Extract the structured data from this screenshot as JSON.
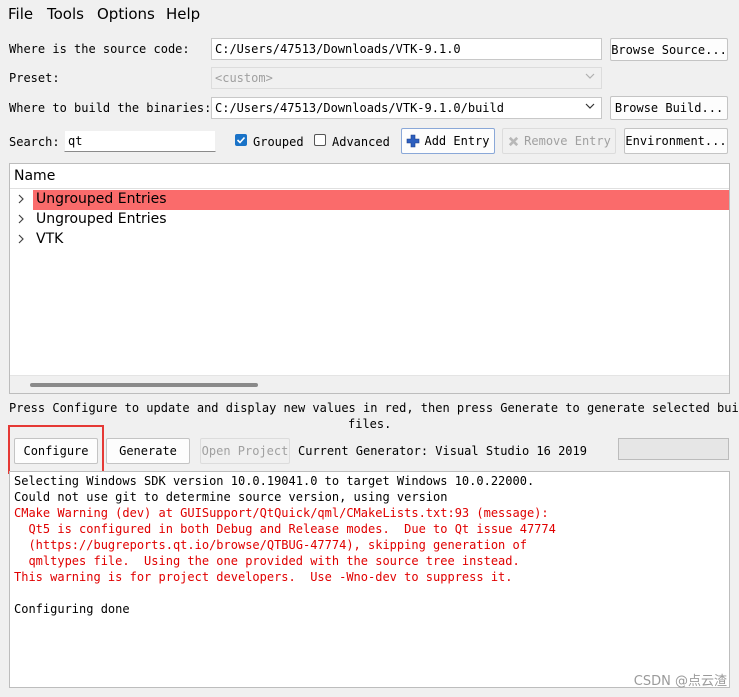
{
  "menu": [
    "File",
    "Tools",
    "Options",
    "Help"
  ],
  "source": {
    "label": "Where is the source code:",
    "value": "C:/Users/47513/Downloads/VTK-9.1.0",
    "browse_label": "Browse Source..."
  },
  "preset": {
    "label": "Preset:",
    "value": "<custom>"
  },
  "build": {
    "label": "Where to build the binaries:",
    "value": "C:/Users/47513/Downloads/VTK-9.1.0/build",
    "browse_label": "Browse Build..."
  },
  "search": {
    "label": "Search:",
    "value": "qt"
  },
  "options": {
    "grouped_label": "Grouped",
    "grouped_checked": true,
    "advanced_label": "Advanced",
    "advanced_checked": false,
    "add_entry_label": "Add Entry",
    "remove_entry_label": "Remove Entry",
    "environment_label": "Environment..."
  },
  "tree": {
    "header": "Name",
    "rows": [
      {
        "label": "Ungrouped Entries",
        "highlighted": true
      },
      {
        "label": "Ungrouped Entries",
        "highlighted": false
      },
      {
        "label": "VTK",
        "highlighted": false
      }
    ]
  },
  "hint": {
    "line1": "Press Configure to update and display new values in red, then press Generate to generate selected build",
    "line2": "files."
  },
  "actions": {
    "configure_label": "Configure",
    "generate_label": "Generate",
    "open_project_label": "Open Project",
    "generator_text": "Current Generator: Visual Studio 16 2019"
  },
  "output": [
    {
      "text": "Selecting Windows SDK version 10.0.19041.0 to target Windows 10.0.22000.",
      "red": false
    },
    {
      "text": "Could not use git to determine source version, using version",
      "red": false
    },
    {
      "text": "CMake Warning (dev) at GUISupport/QtQuick/qml/CMakeLists.txt:93 (message):",
      "red": true
    },
    {
      "text": "  Qt5 is configured in both Debug and Release modes.  Due to Qt issue 47774",
      "red": true
    },
    {
      "text": "  (https://bugreports.qt.io/browse/QTBUG-47774), skipping generation of",
      "red": true
    },
    {
      "text": "  qmltypes file.  Using the one provided with the source tree instead.",
      "red": true
    },
    {
      "text": "This warning is for project developers.  Use -Wno-dev to suppress it.",
      "red": true
    },
    {
      "text": "",
      "red": false
    },
    {
      "text": "Configuring done",
      "red": false
    }
  ],
  "watermark": "CSDN @点云渣",
  "colors": {
    "highlight_row": "#fa6b6b",
    "checkbox_blue": "#1a73c8",
    "warning_red": "#e00000",
    "annotation_box": "#e53935"
  }
}
